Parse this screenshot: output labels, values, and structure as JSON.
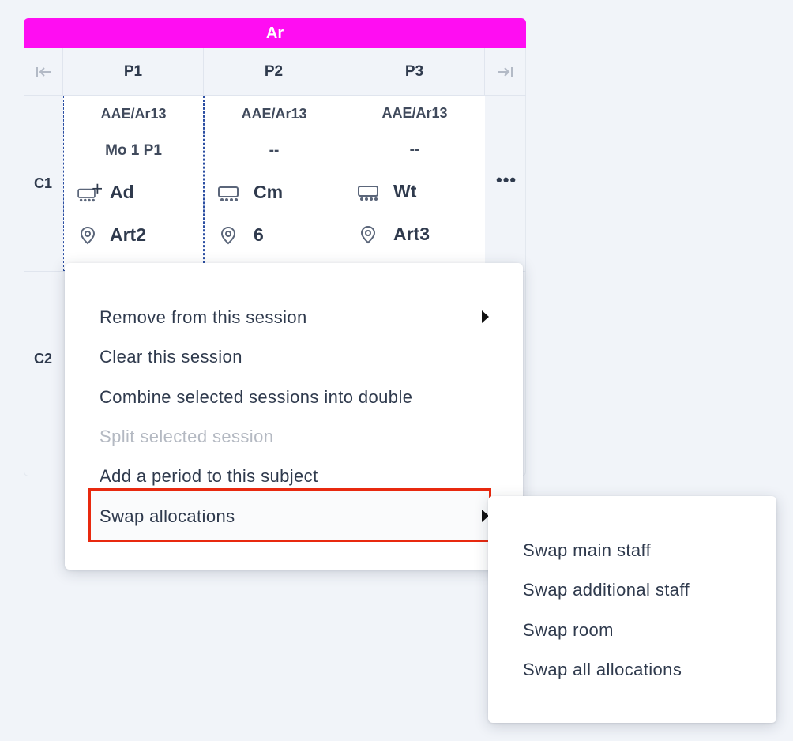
{
  "grid": {
    "title": "Ar",
    "title_color": "#ff0df2",
    "nav_first_icon": "first-page-icon",
    "nav_last_icon": "last-page-icon",
    "periods": [
      "P1",
      "P2",
      "P3"
    ],
    "rows": [
      "C1",
      "C2"
    ],
    "cells": [
      {
        "class_code": "AAE/Ar13",
        "slot": "Mo 1 P1",
        "staff": "Ad",
        "room": "Art2"
      },
      {
        "class_code": "AAE/Ar13",
        "slot": "--",
        "staff": "Cm",
        "room": "6"
      },
      {
        "class_code": "AAE/Ar13",
        "slot": "--",
        "staff": "Wt",
        "room": "Art3"
      }
    ],
    "more_label": "•••"
  },
  "context_menu": {
    "items": [
      {
        "label": "Remove from this session",
        "submenu": true,
        "disabled": false
      },
      {
        "label": "Clear this session",
        "submenu": false,
        "disabled": false
      },
      {
        "label": "Combine selected sessions into double",
        "submenu": false,
        "disabled": false
      },
      {
        "label": "Split selected session",
        "submenu": false,
        "disabled": true
      },
      {
        "label": "Add a period to this subject",
        "submenu": false,
        "disabled": false
      },
      {
        "label": "Swap allocations",
        "submenu": true,
        "disabled": false,
        "highlighted": true
      }
    ],
    "highlight_color": "#e8290f"
  },
  "swap_submenu": {
    "items": [
      {
        "label": "Swap main staff"
      },
      {
        "label": "Swap additional staff"
      },
      {
        "label": "Swap room"
      },
      {
        "label": "Swap all allocations"
      }
    ]
  }
}
